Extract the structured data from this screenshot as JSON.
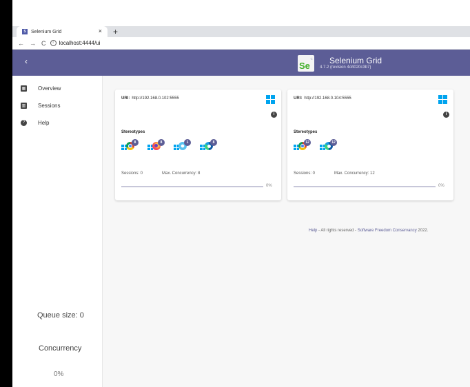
{
  "browser": {
    "tab_title": "Selenium Grid",
    "tab_close": "×",
    "new_tab": "+",
    "nav_back": "←",
    "nav_forward": "→",
    "nav_reload": "C",
    "url_info": "i",
    "url": "localhost:4444/ui"
  },
  "header": {
    "back": "‹",
    "logo_text": "Se",
    "title": "Selenium Grid",
    "revision": "4.7.2 (revision 4d4020c3b7)"
  },
  "sidebar": {
    "items": [
      {
        "label": "Overview",
        "icon": "dashboard-icon"
      },
      {
        "label": "Sessions",
        "icon": "assessment-icon"
      },
      {
        "label": "Help",
        "icon": "help-icon"
      }
    ],
    "queue_size": "Queue size: 0",
    "concurrency_title": "Concurrency",
    "concurrency_value": "0%"
  },
  "nodes": [
    {
      "uri_label": "URI:",
      "uri": "http://192.168.0.102:5555",
      "os_icon": "windows-icon",
      "stereotypes_label": "Stereotypes",
      "browsers": [
        {
          "name": "chrome",
          "count": "8"
        },
        {
          "name": "firefox",
          "count": "8"
        },
        {
          "name": "internet-explorer",
          "count": "1"
        },
        {
          "name": "edge",
          "count": "8"
        }
      ],
      "sessions": "Sessions: 0",
      "max_concurrency": "Max. Concurrency: 8",
      "usage_fraction": 0,
      "usage_percent": "0%"
    },
    {
      "uri_label": "URI:",
      "uri": "http://192.168.0.104:5555",
      "os_icon": "windows-icon",
      "stereotypes_label": "Stereotypes",
      "browsers": [
        {
          "name": "chrome",
          "count": "12"
        },
        {
          "name": "edge",
          "count": "12"
        }
      ],
      "sessions": "Sessions: 0",
      "max_concurrency": "Max. Concurrency: 12",
      "usage_fraction": 0,
      "usage_percent": "0%"
    }
  ],
  "footer": {
    "help": "Help",
    "rights": " - All rights reserved - ",
    "org": "Software Freedom Conservancy",
    "year": " 2022."
  },
  "colors": {
    "header": "#5c5d96",
    "windows": "#00a4ef"
  }
}
